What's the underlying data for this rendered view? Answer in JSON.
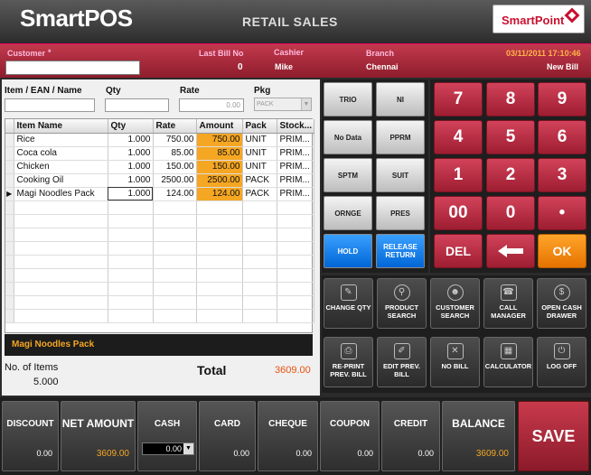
{
  "header": {
    "brand": "SmartPOS",
    "screen_title": "RETAIL SALES",
    "logo_text": "SmartPoint"
  },
  "info": {
    "customer_label": "Customer",
    "customer_marker": "*",
    "last_bill_label": "Last Bill No",
    "last_bill_value": "0",
    "cashier_label": "Cashier",
    "cashier_value": "Mike",
    "branch_label": "Branch",
    "branch_value": "Chennai",
    "datetime": "03/11/2011 17:10:46",
    "bill_status": "New Bill"
  },
  "entry": {
    "item_label": "Item / EAN / Name",
    "qty_label": "Qty",
    "rate_label": "Rate",
    "rate_value": "0.00",
    "pkg_label": "Pkg",
    "pkg_value": "PACK"
  },
  "grid": {
    "columns": [
      "Item Name",
      "Qty",
      "Rate",
      "Amount",
      "Pack",
      "Stock..."
    ],
    "rows": [
      {
        "name": "Rice",
        "qty": "1.000",
        "rate": "750.00",
        "amount": "750.00",
        "pack": "UNIT",
        "stock": "PRIM..."
      },
      {
        "name": "Coca cola",
        "qty": "1.000",
        "rate": "85.00",
        "amount": "85.00",
        "pack": "UNIT",
        "stock": "PRIM..."
      },
      {
        "name": "Chicken",
        "qty": "1.000",
        "rate": "150.00",
        "amount": "150.00",
        "pack": "UNIT",
        "stock": "PRIM..."
      },
      {
        "name": "Cooking Oil",
        "qty": "1.000",
        "rate": "2500.00",
        "amount": "2500.00",
        "pack": "PACK",
        "stock": "PRIM..."
      },
      {
        "name": "Magi Noodles Pack",
        "qty": "1.000",
        "rate": "124.00",
        "amount": "124.00",
        "pack": "PACK",
        "stock": "PRIM...",
        "indicator": "▶"
      }
    ]
  },
  "summary": {
    "selected_item": "Magi Noodles Pack",
    "items_label": "No. of Items",
    "items_value": "5.000",
    "total_label": "Total",
    "total_value": "3609.00"
  },
  "shortcut_keys": [
    "TRIO",
    "NI",
    "No Data",
    "PPRM",
    "SPTM",
    "SUIT",
    "ORNGE",
    "PRES",
    "HOLD",
    "RELEASE RETURN"
  ],
  "numpad": {
    "keys": [
      "7",
      "8",
      "9",
      "4",
      "5",
      "6",
      "1",
      "2",
      "3",
      "00",
      "0",
      "•"
    ],
    "del": "DEL",
    "back_arrow": "🡐",
    "ok": "OK"
  },
  "functions": [
    {
      "label": "CHANGE QTY",
      "icon": "✎"
    },
    {
      "label": "PRODUCT SEARCH",
      "icon": "⚲"
    },
    {
      "label": "CUSTOMER SEARCH",
      "icon": "☻"
    },
    {
      "label": "CALL MANAGER",
      "icon": "☎"
    },
    {
      "label": "OPEN CASH DRAWER",
      "icon": "$"
    },
    {
      "label": "RE-PRINT PREV. BILL",
      "icon": "⎙"
    },
    {
      "label": "EDIT PREV. BILL",
      "icon": "✐"
    },
    {
      "label": "NO BILL",
      "icon": "✕"
    },
    {
      "label": "CALCULATOR",
      "icon": "▦"
    },
    {
      "label": "LOG OFF",
      "icon": "⏻"
    }
  ],
  "payments": [
    {
      "label": "DISCOUNT",
      "value": "0.00"
    },
    {
      "label": "NET AMOUNT",
      "value": "3609.00"
    },
    {
      "label": "CASH",
      "value": "0.00"
    },
    {
      "label": "CARD",
      "value": "0.00"
    },
    {
      "label": "CHEQUE",
      "value": "0.00"
    },
    {
      "label": "COUPON",
      "value": "0.00"
    },
    {
      "label": "CREDIT",
      "value": "0.00"
    },
    {
      "label": "BALANCE",
      "value": "3609.00"
    }
  ],
  "save_label": "SAVE",
  "colors": {
    "accent_red": "#b42a3e",
    "highlight_orange": "#f5a623",
    "button_blue": "#1a7ff0"
  }
}
